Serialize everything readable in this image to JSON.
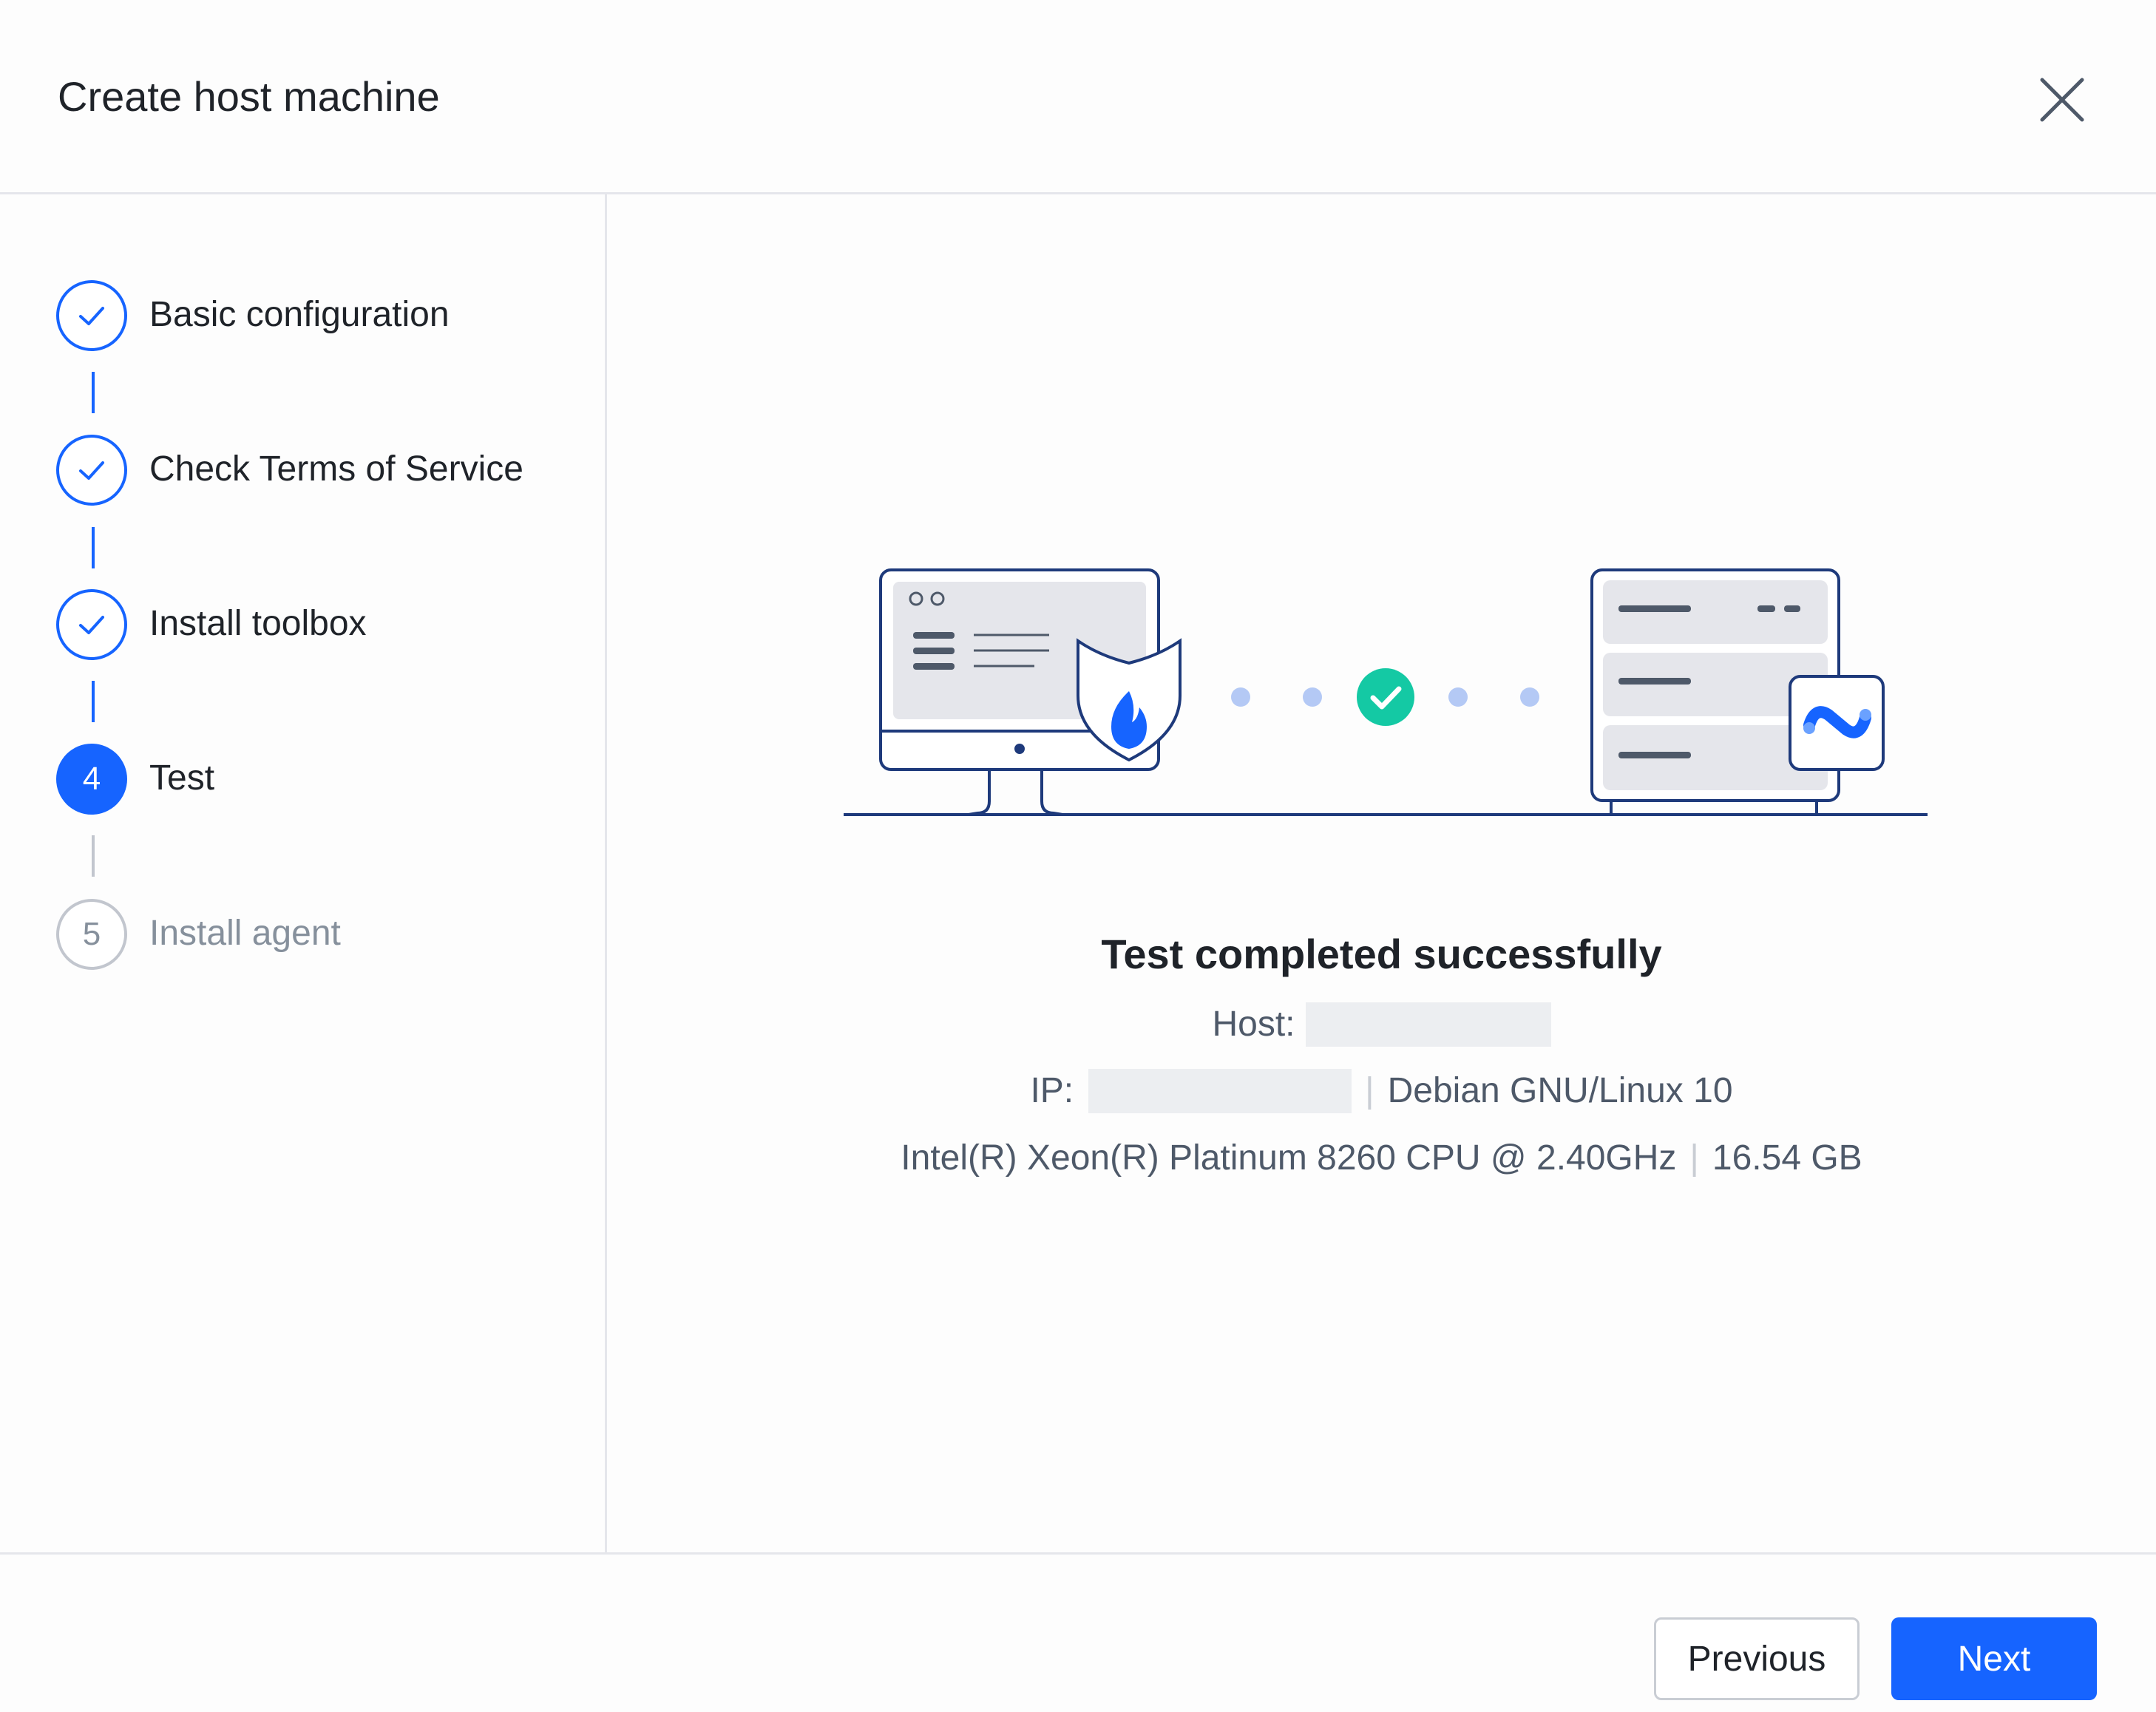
{
  "dialog": {
    "title": "Create host machine"
  },
  "steps": [
    {
      "number": "1",
      "label": "Basic configuration",
      "status": "done"
    },
    {
      "number": "2",
      "label": "Check Terms of Service",
      "status": "done"
    },
    {
      "number": "3",
      "label": "Install toolbox",
      "status": "done"
    },
    {
      "number": "4",
      "label": "Test",
      "status": "active"
    },
    {
      "number": "5",
      "label": "Install agent",
      "status": "pending"
    }
  ],
  "result": {
    "title": "Test completed successfully",
    "host_label": "Host:",
    "ip_label": "IP:",
    "os": "Debian GNU/Linux 10",
    "cpu": "Intel(R) Xeon(R) Platinum 8260 CPU @ 2.40GHz",
    "memory": "16.54 GB",
    "separator": "|"
  },
  "footer": {
    "previous_label": "Previous",
    "next_label": "Next"
  },
  "colors": {
    "primary": "#1664ff",
    "success": "#14c9a4",
    "illustration_line": "#1e3a7b"
  },
  "icons": [
    "close-icon",
    "check-icon",
    "firewall-shield-icon",
    "success-check-icon",
    "agent-logo-icon"
  ]
}
